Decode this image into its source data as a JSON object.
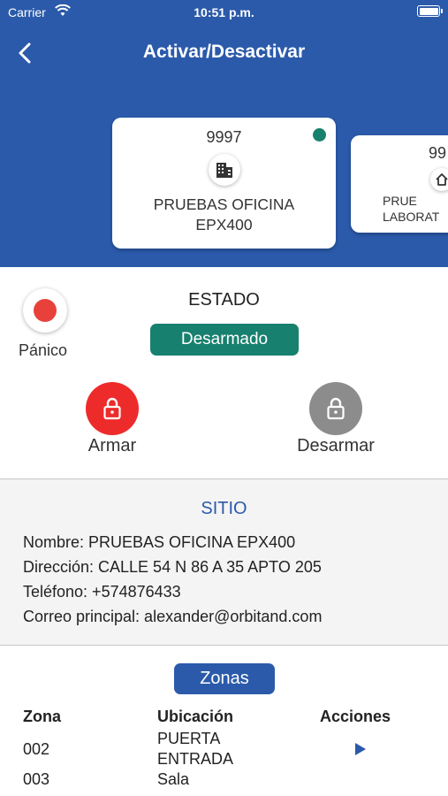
{
  "status_bar": {
    "carrier": "Carrier",
    "time": "10:51 p.m."
  },
  "nav": {
    "title": "Activar/Desactivar",
    "back_icon": "chevron-left-icon"
  },
  "cards": [
    {
      "code": "9997",
      "icon": "building-icon",
      "name_line1": "PRUEBAS OFICINA",
      "name_line2": "EPX400",
      "status_color": "#18806f",
      "selected": true
    },
    {
      "code": "99",
      "icon": "home-icon",
      "name_line1": "PRUE",
      "name_line2": "LABORAT"
    }
  ],
  "panic": {
    "label": "Pánico"
  },
  "estado": {
    "title": "ESTADO",
    "value": "Desarmado",
    "color": "#18806f"
  },
  "actions": {
    "arm_label": "Armar",
    "disarm_label": "Desarmar"
  },
  "site": {
    "title": "SITIO",
    "nombre": "Nombre: PRUEBAS OFICINA EPX400",
    "direccion": "Dirección: CALLE 54 N 86 A 35 APTO 205",
    "telefono": "Teléfono: +574876433",
    "correo": "Correo principal: alexander@orbitand.com"
  },
  "zones": {
    "button_label": "Zonas",
    "headers": {
      "zona": "Zona",
      "ubicacion": "Ubicación",
      "acciones": "Acciones"
    },
    "rows": [
      {
        "zona": "002",
        "ubicacion_line1": "PUERTA",
        "ubicacion_line2": "ENTRADA"
      },
      {
        "zona": "003",
        "ubicacion_line1": "Sala",
        "ubicacion_line2": ""
      }
    ]
  },
  "colors": {
    "primary": "#2b5aaa",
    "armed_red": "#ee2b2b",
    "disarm_gray": "#8c8c8c",
    "status_green": "#18806f"
  }
}
